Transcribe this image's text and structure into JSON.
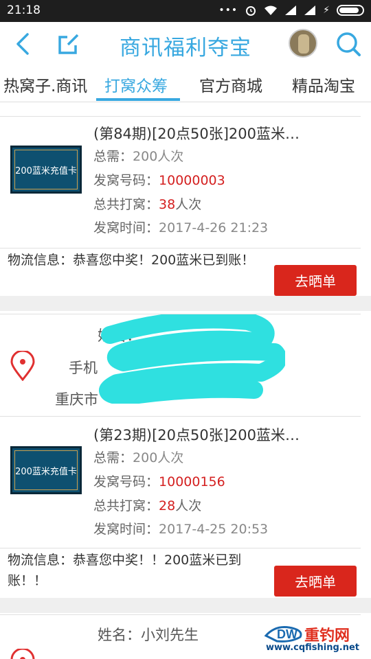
{
  "status_bar": {
    "time": "21:18"
  },
  "header": {
    "title": "商讯福利夺宝"
  },
  "tabs": [
    {
      "label": "热窝子.商讯"
    },
    {
      "label": "打窝众筹"
    },
    {
      "label": "官方商城"
    },
    {
      "label": "精品淘宝"
    }
  ],
  "records": [
    {
      "thumb_label": "200蓝米充值卡",
      "name": "(第84期)[20点50张]200蓝米…",
      "need_label": "总需：",
      "need": "200人次",
      "code_label": "发窝号码：",
      "code": "10000003",
      "total_label": "总共打窝：",
      "total_num": "38",
      "total_unit": "人次",
      "time_label": "发窝时间：",
      "time": "2017-4-26 21:23",
      "logistics": "物流信息：恭喜您中奖！200蓝米已到账！",
      "button": "去晒单"
    },
    {
      "thumb_label": "200蓝米充值卡",
      "name": "(第23期)[20点50张]200蓝米…",
      "need_label": "总需：",
      "need": "200人次",
      "code_label": "发窝号码：",
      "code": "10000156",
      "total_label": "总共打窝：",
      "total_num": "28",
      "total_unit": "人次",
      "time_label": "发窝时间：",
      "time": "2017-4-25 20:53",
      "logistics": "物流信息：恭喜您中奖！！200蓝米已到账！！",
      "button": "去晒单"
    }
  ],
  "address_blocks": [
    {
      "name_label": "姓名：",
      "phone_label": "手机",
      "addr_prefix": "重庆市"
    },
    {
      "name": "姓名：小刘先生"
    }
  ],
  "watermark": {
    "brand": "重钓网",
    "url": "www.cqfishing.net"
  },
  "colors": {
    "accent": "#38a8e0",
    "button": "#d9261c",
    "highlight": "#d42020",
    "scribble": "#2fe0e0"
  }
}
